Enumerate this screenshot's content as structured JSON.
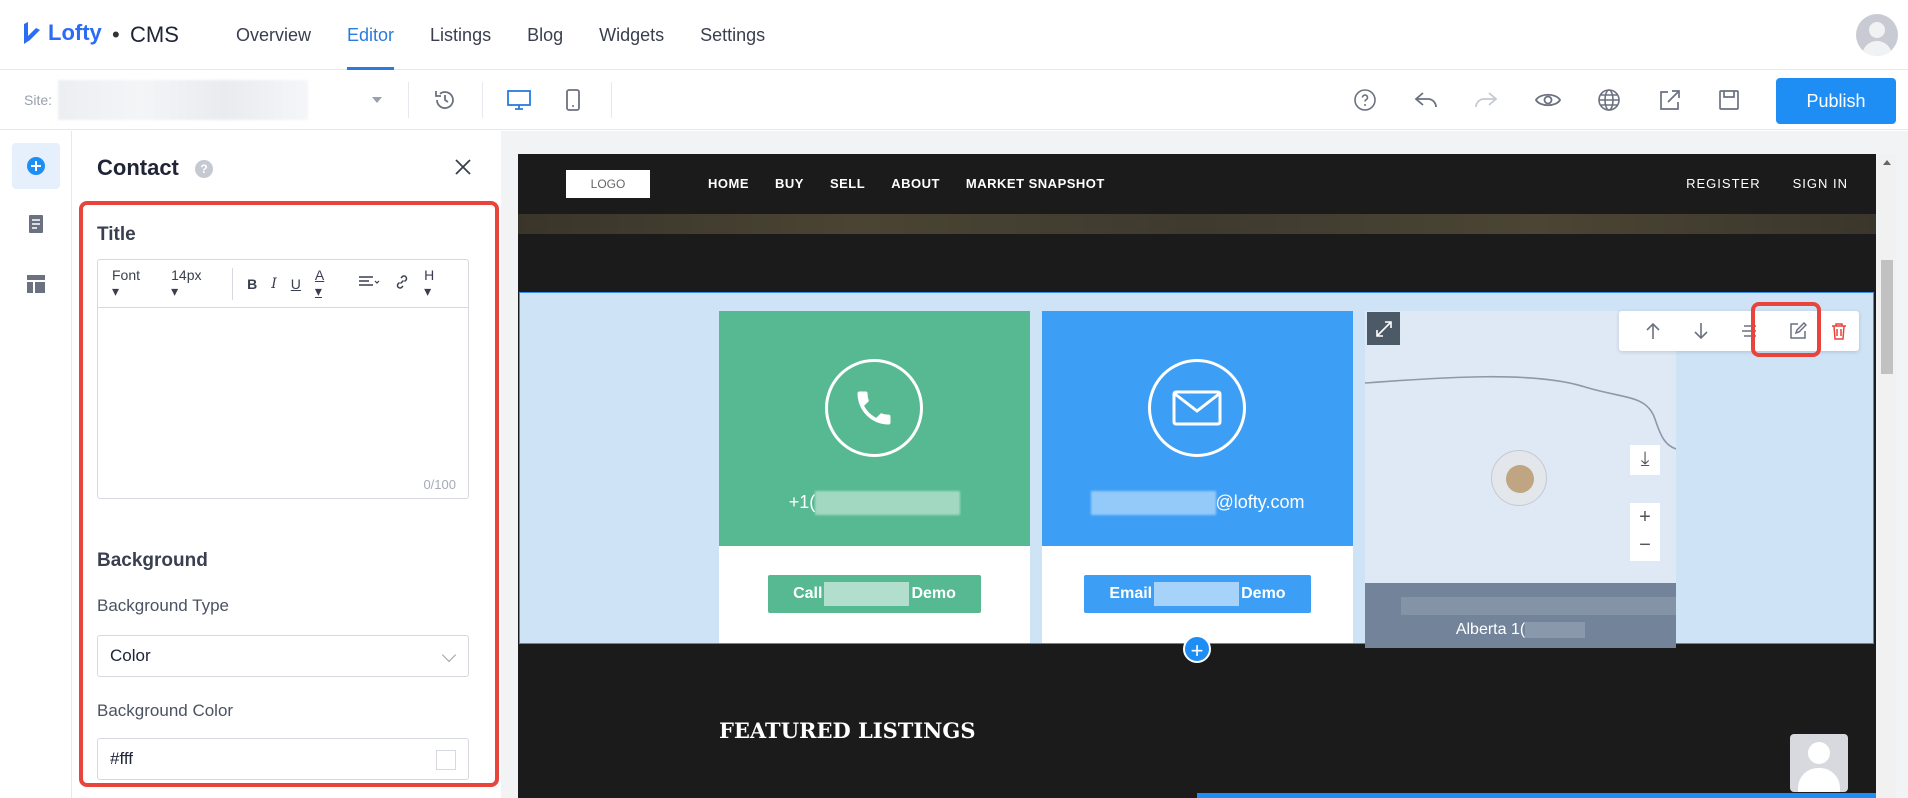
{
  "brand": {
    "name": "Lofty",
    "separator": "•",
    "product": "CMS"
  },
  "nav": {
    "tabs": [
      {
        "label": "Overview"
      },
      {
        "label": "Editor"
      },
      {
        "label": "Listings"
      },
      {
        "label": "Blog"
      },
      {
        "label": "Widgets"
      },
      {
        "label": "Settings"
      }
    ],
    "active": "Editor"
  },
  "toolbar": {
    "site_label": "Site:",
    "publish_label": "Publish",
    "icons": [
      "history-icon",
      "desktop-icon",
      "mobile-icon",
      "help-icon",
      "undo-icon",
      "redo-icon",
      "preview-icon",
      "globe-icon",
      "share-icon",
      "save-icon"
    ]
  },
  "rail": {
    "icons": [
      "add-icon",
      "pages-icon",
      "layout-icon"
    ]
  },
  "panel": {
    "title": "Contact",
    "help": "?",
    "title_section": "Title",
    "editor": {
      "font": "Font",
      "size": "14px",
      "bold": "B",
      "italic": "I",
      "underline": "U",
      "color": "A",
      "heading": "H",
      "count": "0/100"
    },
    "background_section": "Background",
    "bg_type_label": "Background Type",
    "bg_type_value": "Color",
    "bg_color_label": "Background Color",
    "bg_color_value": "#fff"
  },
  "site": {
    "logo": "LOGO",
    "menu": [
      "HOME",
      "BUY",
      "SELL",
      "ABOUT",
      "MARKET SNAPSHOT"
    ],
    "right": [
      "REGISTER",
      "SIGN IN"
    ],
    "phone_prefix": "+1(",
    "email_suffix": "@lofty.com",
    "call_btn": {
      "a": "Call",
      "b": "Demo"
    },
    "email_btn": {
      "a": "Email",
      "b": "Demo"
    },
    "map_address": "Alberta 1(",
    "map_zoom_in": "+",
    "map_zoom_out": "−",
    "add_section": "+",
    "featured": "FEATURED LISTINGS"
  },
  "colors": {
    "accent": "#1e8ef5",
    "green": "#56b991",
    "blue": "#3d9ef5",
    "highlight": "#e8443c"
  }
}
